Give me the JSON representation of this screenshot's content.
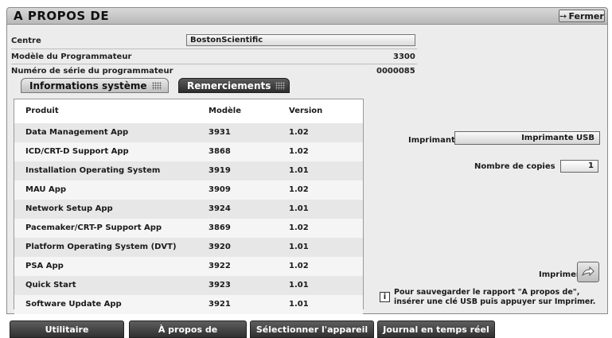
{
  "window": {
    "title": "A PROPOS DE",
    "close_label": "Fermer"
  },
  "info": {
    "center_label": "Centre",
    "center_value": "BostonScientific",
    "model_label": "Modèle du Programmateur",
    "model_value": "3300",
    "serial_label": "Numéro de série du programmateur",
    "serial_value": "0000085"
  },
  "tabs": [
    {
      "label": "Informations système",
      "active": true
    },
    {
      "label": "Remerciements",
      "active": false
    }
  ],
  "table": {
    "headers": [
      "Produit",
      "Modèle",
      "Version"
    ],
    "rows": [
      [
        "Data Management App",
        "3931",
        "1.02"
      ],
      [
        "ICD/CRT-D Support App",
        "3868",
        "1.02"
      ],
      [
        "Installation Operating System",
        "3919",
        "1.01"
      ],
      [
        "MAU App",
        "3909",
        "1.02"
      ],
      [
        "Network Setup App",
        "3924",
        "1.01"
      ],
      [
        "Pacemaker/CRT-P Support App",
        "3869",
        "1.02"
      ],
      [
        "Platform Operating System (DVT)",
        "3920",
        "1.01"
      ],
      [
        "PSA App",
        "3922",
        "1.02"
      ],
      [
        "Quick Start",
        "3923",
        "1.01"
      ],
      [
        "Software Update App",
        "3921",
        "1.01"
      ]
    ]
  },
  "printer": {
    "label": "Imprimante",
    "value": "Imprimante USB",
    "copies_label": "Nombre de copies",
    "copies_value": "1",
    "print_label": "Imprimer"
  },
  "note": "Pour sauvegarder le rapport \"A propos de\", insérer une clé USB puis appuyer sur Imprimer.",
  "bottom_nav": [
    "Utilitaire",
    "À propos de",
    "Sélectionner l'appareil",
    "Journal en temps réel"
  ]
}
